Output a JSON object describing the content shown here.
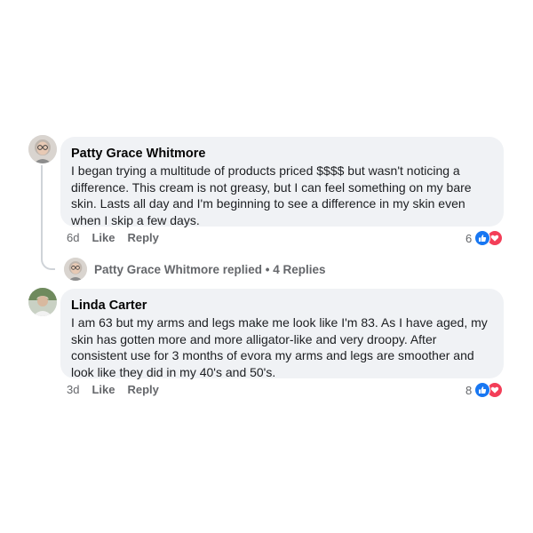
{
  "comments": [
    {
      "author": "Patty Grace Whitmore",
      "text": "I began trying a multitude of products priced $$$$ but wasn't noticing a difference. This cream is not greasy, but I can feel something on my bare skin. Lasts all day and I'm beginning to see a difference in my skin even when I skip a few days.",
      "time": "6d",
      "like_label": "Like",
      "reply_label": "Reply",
      "reaction_count": "6",
      "reactions": [
        "like-icon",
        "love-icon"
      ]
    },
    {
      "author": "Linda Carter",
      "text": "I am 63 but my arms and legs make me look like I'm 83. As I have aged, my skin has gotten more and more alligator-like and very droopy. After consistent use for 3 months of evora my arms and legs are smoother and look like they did in my 40's and 50's.",
      "time": "3d",
      "like_label": "Like",
      "reply_label": "Reply",
      "reaction_count": "8",
      "reactions": [
        "like-icon",
        "love-icon"
      ]
    }
  ],
  "replies": {
    "text": "Patty Grace Whitmore replied • 4 Replies"
  },
  "colors": {
    "bubble": "#f0f2f5",
    "muted": "#65676b",
    "like": "#1877f2",
    "love": "#f33e58"
  }
}
